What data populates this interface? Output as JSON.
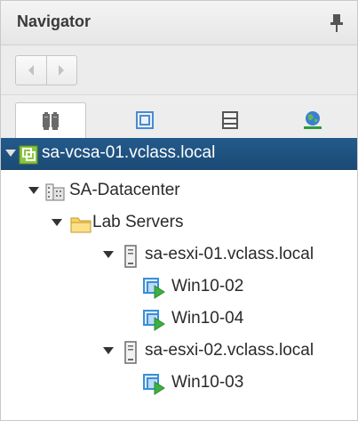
{
  "header": {
    "title": "Navigator"
  },
  "icons": {
    "pin": "pin-icon",
    "back": "back-arrow-icon",
    "forward": "forward-arrow-icon",
    "hosts_clusters": "hosts-and-clusters-icon",
    "vms_templates": "vms-and-templates-icon",
    "storage": "storage-icon",
    "networking": "networking-icon"
  },
  "tree": {
    "vcenter": "sa-vcsa-01.vclass.local",
    "datacenter": "SA-Datacenter",
    "folder": "Lab Servers",
    "host1": "sa-esxi-01.vclass.local",
    "vm1": "Win10-02",
    "vm2": "Win10-04",
    "host2": "sa-esxi-02.vclass.local",
    "vm3": "Win10-03"
  },
  "colors": {
    "selection": "#1f4e79",
    "folder": "#f5c84c",
    "vm_blue": "#3a8fd6",
    "vm_green": "#3cb043"
  }
}
